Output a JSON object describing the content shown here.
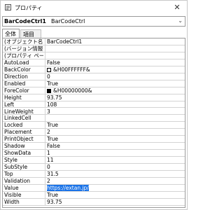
{
  "window": {
    "title": "プロパティ"
  },
  "object_selector": {
    "name": "BarCodeCtrl1",
    "type": "BarCodeCtrl"
  },
  "tabs": [
    {
      "label": "全体",
      "active": true
    },
    {
      "label": "項目別",
      "active": false
    }
  ],
  "properties": [
    {
      "name": "(オブジェクト名)",
      "value": "BarCodeCtrl1"
    },
    {
      "name": "(バージョン情報)",
      "value": ""
    },
    {
      "name": "(プロパティ ページ)",
      "value": ""
    },
    {
      "name": "AutoLoad",
      "value": "False"
    },
    {
      "name": "BackColor",
      "value": "&H00FFFFFF&",
      "swatch": "#ffffff"
    },
    {
      "name": "Direction",
      "value": "0"
    },
    {
      "name": "Enabled",
      "value": "True"
    },
    {
      "name": "ForeColor",
      "value": "&H00000000&",
      "swatch": "#000000"
    },
    {
      "name": "Height",
      "value": "93.75"
    },
    {
      "name": "Left",
      "value": "108"
    },
    {
      "name": "LineWeight",
      "value": "3"
    },
    {
      "name": "LinkedCell",
      "value": ""
    },
    {
      "name": "Locked",
      "value": "True"
    },
    {
      "name": "Placement",
      "value": "2"
    },
    {
      "name": "PrintObject",
      "value": "True"
    },
    {
      "name": "Shadow",
      "value": "False"
    },
    {
      "name": "ShowData",
      "value": "1"
    },
    {
      "name": "Style",
      "value": "11"
    },
    {
      "name": "SubStyle",
      "value": "0"
    },
    {
      "name": "Top",
      "value": "31.5"
    },
    {
      "name": "Validation",
      "value": "2"
    },
    {
      "name": "Value",
      "value": "https://extan.jp/",
      "selected": true
    },
    {
      "name": "Visible",
      "value": "True"
    },
    {
      "name": "Width",
      "value": "93.75"
    }
  ]
}
